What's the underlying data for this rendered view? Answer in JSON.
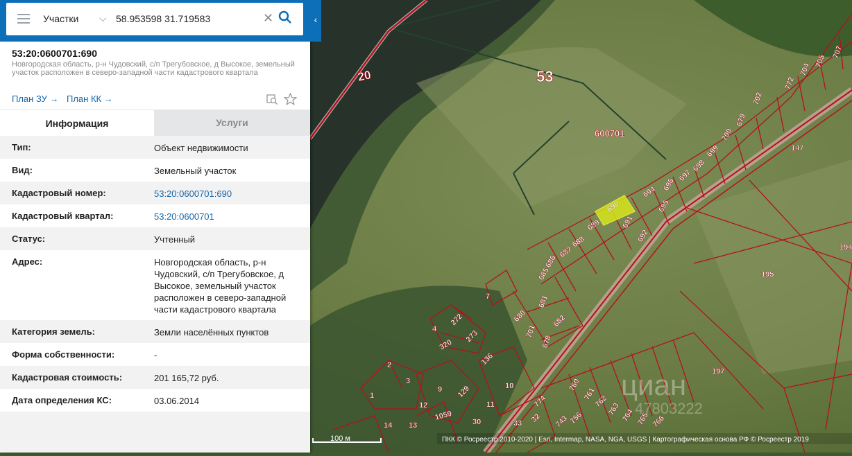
{
  "search": {
    "type": "Участки",
    "value": "58.953598 31.719583"
  },
  "parcel": {
    "number": "53:20:0600701:690",
    "description": "Новгородская область, р-н Чудовский, с/п Трегубовское, д Высокое, земельный участок расположен в северо-западной части кадастрового квартала"
  },
  "links": {
    "plan_zu": "План ЗУ →",
    "plan_kk": "План КК →"
  },
  "tabs": {
    "info": "Информация",
    "services": "Услуги"
  },
  "info": [
    {
      "label": "Тип:",
      "value": "Объект недвижимости"
    },
    {
      "label": "Вид:",
      "value": "Земельный участок"
    },
    {
      "label": "Кадастровый номер:",
      "value": "53:20:0600701:690"
    },
    {
      "label": "Кадастровый квартал:",
      "value": "53:20:0600701"
    },
    {
      "label": "Статус:",
      "value": "Учтенный"
    },
    {
      "label": "Адрес:",
      "value": "Новгородская область, р-н Чудовский, с/п Трегубовское, д Высокое, земельный участок расположен в северо-западной части кадастрового квартала"
    },
    {
      "label": "Категория земель:",
      "value": "Земли населённых пунктов"
    },
    {
      "label": "Форма собственности:",
      "value": "-"
    },
    {
      "label": "Кадастровая стоимость:",
      "value": "201 165,72 руб."
    },
    {
      "label": "Дата определения КС:",
      "value": "03.06.2014"
    }
  ],
  "map": {
    "region_label": "53",
    "road_label": "20",
    "quarter_label": "600701",
    "parcel_labels": [
      "690",
      "689",
      "691",
      "692",
      "688",
      "687",
      "686",
      "685",
      "694",
      "695",
      "696",
      "697",
      "698",
      "699",
      "700",
      "679",
      "702",
      "772",
      "704",
      "705",
      "707",
      "147",
      "195",
      "197",
      "681",
      "680",
      "682",
      "701",
      "678",
      "7",
      "4",
      "272",
      "273",
      "320",
      "136",
      "2",
      "3",
      "1",
      "9",
      "129",
      "10",
      "11",
      "12",
      "13",
      "14",
      "1059",
      "30",
      "33",
      "32",
      "774",
      "743",
      "756",
      "760",
      "761",
      "762",
      "763",
      "764",
      "765",
      "766",
      "194"
    ],
    "scale": "100 м",
    "attribution": "ПКК © Росреестр 2010-2020 | Esri, Intermap, NASA, NGA, USGS | Картографическая основа РФ © Росреестр 2019",
    "watermark": "циан",
    "watermark_id": "47803222"
  },
  "colors": {
    "accent": "#0d6fb8",
    "link": "#1565a8",
    "selected_parcel": "#d7e51a",
    "boundary": "#b3121c"
  }
}
